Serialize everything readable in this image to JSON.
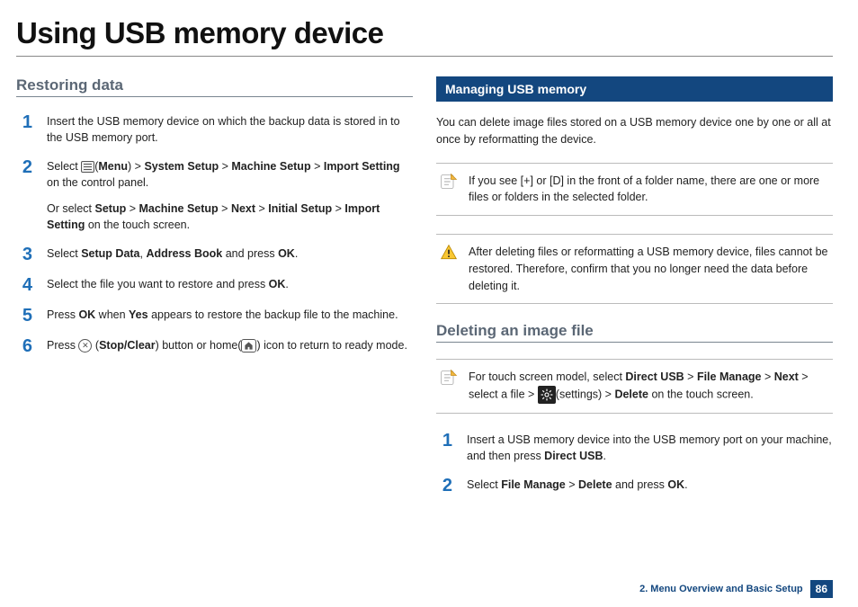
{
  "page": {
    "title": "Using USB memory device",
    "footer_chapter": "2. Menu Overview and Basic Setup",
    "footer_page": "86"
  },
  "left": {
    "section_title": "Restoring data",
    "steps": [
      {
        "num": "1",
        "paras": [
          "Insert the USB memory device on which the backup data is stored in to the USB memory port."
        ]
      },
      {
        "num": "2",
        "paras": [
          "Select [menu-icon](<b>Menu</b>) > <b>System Setup</b> > <b>Machine Setup</b> > <b>Import Setting</b> on the control panel.",
          "Or select <b>Setup</b> > <b>Machine Setup</b> > <b>Next</b> > <b>Initial Setup</b> > <b>Import Setting</b> on the touch screen."
        ]
      },
      {
        "num": "3",
        "paras": [
          "Select <b>Setup Data</b>, <b>Address Book</b> and press <b>OK</b>."
        ]
      },
      {
        "num": "4",
        "paras": [
          "Select the file you want to restore and press <b>OK</b>."
        ]
      },
      {
        "num": "5",
        "paras": [
          "Press <b>OK</b> when <b>Yes</b> appears to restore the backup file to the machine."
        ]
      },
      {
        "num": "6",
        "paras": [
          "Press [stop-icon] (<b>Stop/Clear</b>) button or home([home-icon]) icon to return to ready mode."
        ]
      }
    ]
  },
  "right": {
    "bar_title": "Managing USB memory",
    "intro": "You can delete image files stored on a USB memory device one by one or all at once by reformatting the device.",
    "note1": "If you see [+] or [D] in the front of a folder name, there are one or more files or folders in the selected folder.",
    "warn1": "After deleting files or reformatting a USB memory device, files cannot be restored. Therefore, confirm that you no longer need the data before deleting it.",
    "section_title": "Deleting an image file",
    "note2": "For touch screen model, select <b>Direct USB</b> > <b>File Manage</b> > <b>Next</b> > select a file > [gear-icon](settings) > <b>Delete</b> on the touch screen.",
    "steps": [
      {
        "num": "1",
        "paras": [
          "Insert a USB memory device into the USB memory port on your machine, and then press <b>Direct USB</b>."
        ]
      },
      {
        "num": "2",
        "paras": [
          "Select <b>File Manage</b> > <b>Delete</b> and press <b>OK</b>."
        ]
      }
    ]
  }
}
